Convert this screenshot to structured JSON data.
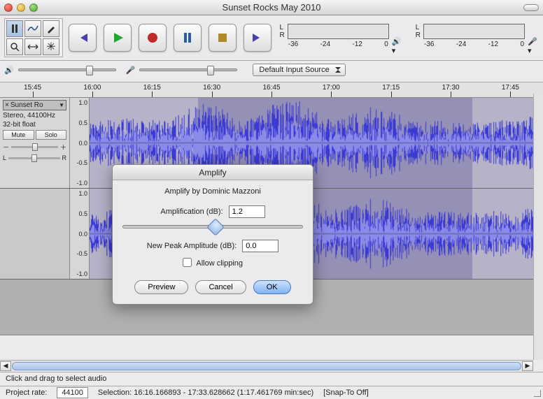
{
  "window_title": "Sunset Rocks May 2010",
  "meter_scale": [
    "-36",
    "-24",
    "-12",
    "0"
  ],
  "meter_channels": [
    "L",
    "R"
  ],
  "input_source": "Default Input Source",
  "timeline_labels": [
    "15:45",
    "16:00",
    "16:15",
    "16:30",
    "16:45",
    "17:00",
    "17:15",
    "17:30",
    "17:45"
  ],
  "track": {
    "name": "Sunset Ro",
    "format_line1": "Stereo, 44100Hz",
    "format_line2": "32-bit float",
    "mute": "Mute",
    "solo": "Solo",
    "pan_l": "L",
    "pan_r": "R",
    "vaxis": [
      "1.0",
      "0.5",
      "0.0",
      "-0.5",
      "-1.0"
    ]
  },
  "dialog": {
    "title": "Amplify",
    "credit": "Amplify by Dominic Mazzoni",
    "amp_label": "Amplification (dB):",
    "amp_value": "1.2",
    "peak_label": "New Peak Amplitude (dB):",
    "peak_value": "0.0",
    "allow_clipping": "Allow clipping",
    "preview": "Preview",
    "cancel": "Cancel",
    "ok": "OK"
  },
  "status": {
    "hint": "Click and drag to select audio",
    "rate_label": "Project rate:",
    "rate_value": "44100",
    "selection": "Selection: 16:16.166893 - 17:33.628662 (1:17.461769 min:sec)",
    "snap": "[Snap-To Off]"
  }
}
